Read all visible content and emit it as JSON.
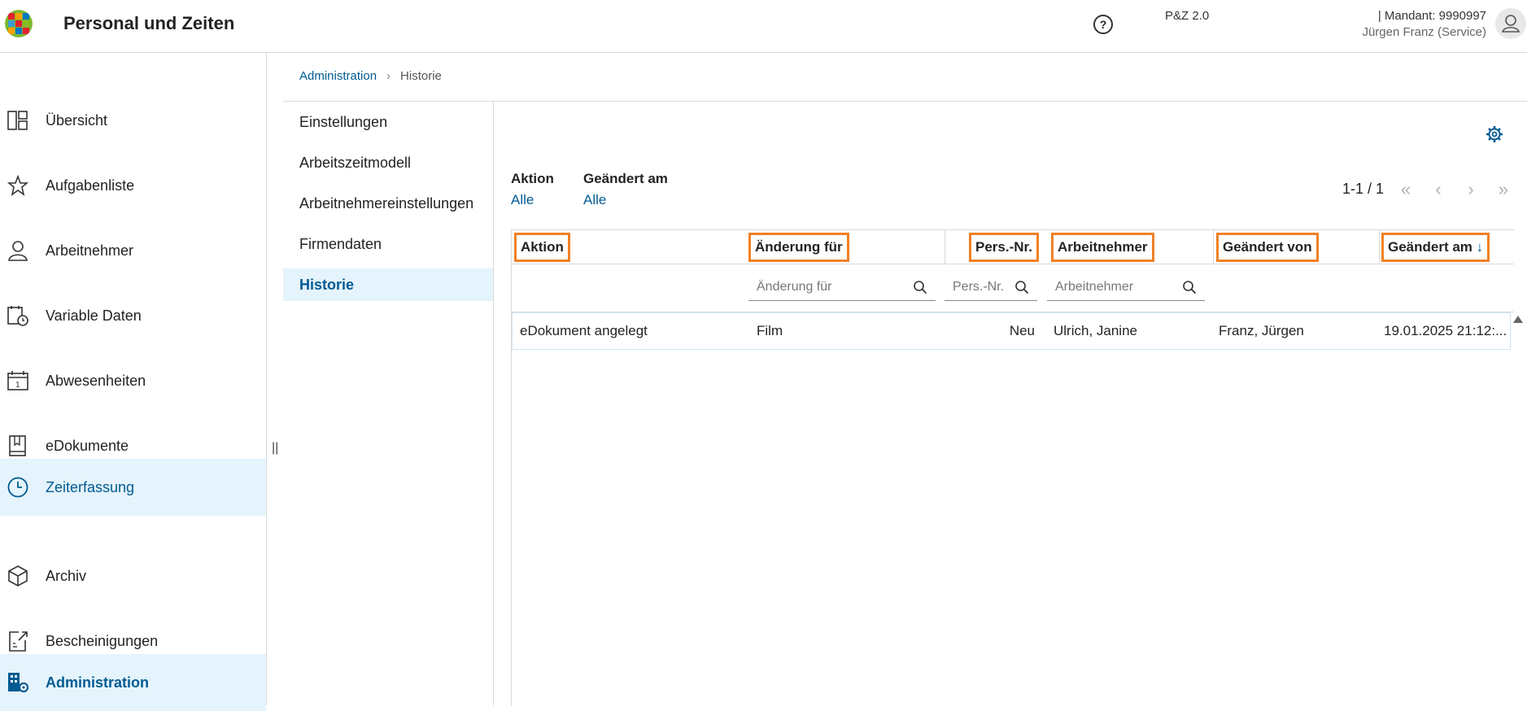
{
  "header": {
    "title": "Personal und Zeiten",
    "help_icon": "question-circle-icon",
    "version": "P&Z 2.0",
    "mandant": "| Mandant: 9990997",
    "user": "Jürgen Franz (Service)"
  },
  "sidebar": {
    "items": [
      {
        "label": "Übersicht",
        "icon": "dashboard-icon"
      },
      {
        "label": "Aufgabenliste",
        "icon": "star-icon"
      },
      {
        "label": "Arbeitnehmer",
        "icon": "person-icon"
      },
      {
        "label": "Variable Daten",
        "icon": "calendar-clock-icon"
      },
      {
        "label": "Abwesenheiten",
        "icon": "calendar-icon"
      },
      {
        "label": "eDokumente",
        "icon": "book-icon"
      },
      {
        "label": "Zeiterfassung",
        "icon": "clock-icon"
      },
      {
        "label": "Archiv",
        "icon": "box-icon"
      },
      {
        "label": "Bescheinigungen",
        "icon": "document-export-icon"
      },
      {
        "label": "Administration",
        "icon": "building-gear-icon"
      }
    ],
    "resize_glyph": "||"
  },
  "breadcrumb": {
    "parent": "Administration",
    "current": "Historie"
  },
  "subnav": {
    "items": [
      "Einstellungen",
      "Arbeitszeitmodell",
      "Arbeitnehmereinstellungen",
      "Firmendaten",
      "Historie"
    ]
  },
  "filters": {
    "aktion_label": "Aktion",
    "aktion_value": "Alle",
    "geaendert_label": "Geändert am",
    "geaendert_value": "Alle"
  },
  "pager": {
    "text": "1-1 / 1",
    "first": "«",
    "prev": "‹",
    "next": "›",
    "last": "»"
  },
  "table": {
    "columns": [
      "Aktion",
      "Änderung für",
      "Pers.-Nr.",
      "Arbeitnehmer",
      "Geändert von",
      "Geändert am"
    ],
    "sort_indicator": "↓",
    "filter_placeholders": {
      "aenderung": "Änderung für",
      "persnr": "Pers.-Nr.",
      "arbeitnehmer": "Arbeitnehmer"
    },
    "rows": [
      {
        "aktion": "eDokument angelegt",
        "aenderung": "Film",
        "persnr": "Neu",
        "arbeitnehmer": "Ulrich, Janine",
        "geaendert_von": "Franz, Jürgen",
        "geaendert_am": "19.01.2025 21:12:..."
      }
    ]
  },
  "colors": {
    "accent": "#005b92",
    "highlight": "#f08024",
    "active_bg": "#e5f3fc"
  }
}
